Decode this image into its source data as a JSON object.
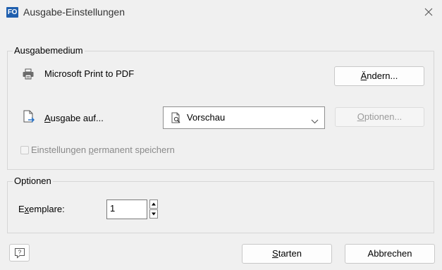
{
  "window": {
    "app_icon_text": "FO",
    "title": "Ausgabe-Einstellungen",
    "close_icon": "close-icon"
  },
  "ausgabemedium": {
    "legend": "Ausgabemedium",
    "printer_icon": "printer-icon",
    "printer_name": "Microsoft Print to PDF",
    "change_button": {
      "accel": "Ä",
      "rest": "ndern..."
    },
    "output_icon": "document-arrow-icon",
    "output_label": {
      "accel": "A",
      "rest": "usgabe auf..."
    },
    "output_select": {
      "icon": "preview-document-icon",
      "value": "Vorschau",
      "chevron_icon": "chevron-down-icon"
    },
    "options_button": {
      "accel": "O",
      "rest": "ptionen...",
      "enabled": false
    },
    "save_permanent": {
      "label_before": "Einstellungen ",
      "accel": "p",
      "label_after": "ermanent speichern",
      "checked": false,
      "enabled": false
    }
  },
  "optionen": {
    "legend": "Optionen",
    "copies_label": {
      "before": "E",
      "accel": "x",
      "after": "emplare:"
    },
    "copies_value": "1"
  },
  "footer": {
    "help_icon": "help-question-icon",
    "start_button": {
      "accel": "S",
      "rest": "tarten"
    },
    "cancel_button": "Abbrechen"
  }
}
